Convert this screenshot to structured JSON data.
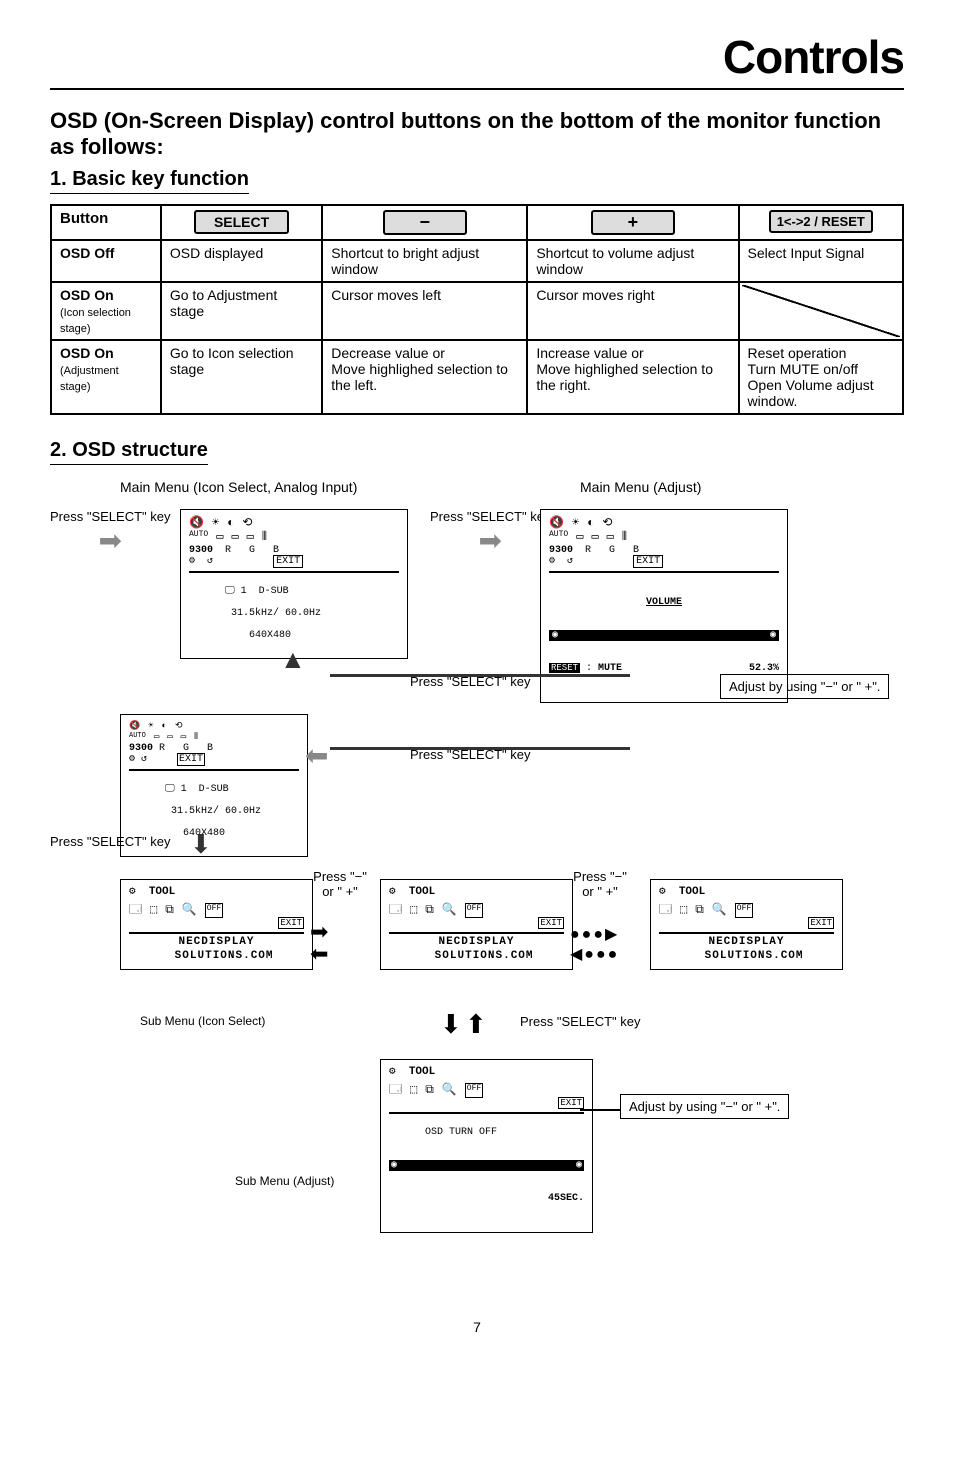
{
  "page_title": "Controls",
  "intro": "OSD (On-Screen Display) control buttons on the bottom of the monitor function as follows:",
  "section1_heading": "1. Basic key function",
  "table": {
    "headers": {
      "button": "Button",
      "select": "SELECT",
      "minus": "−",
      "plus": "+",
      "reset": "1<->2 / RESET"
    },
    "rows": [
      {
        "label": "OSD Off",
        "select": "OSD displayed",
        "minus": "Shortcut to bright adjust window",
        "plus": "Shortcut to volume adjust window",
        "reset": "Select Input Signal"
      },
      {
        "label": "OSD On",
        "label_note": "(Icon selection stage)",
        "select": "Go to Adjustment stage",
        "minus": "Cursor moves left",
        "plus": "Cursor moves right",
        "reset": ""
      },
      {
        "label": "OSD On",
        "label_note": "(Adjustment stage)",
        "select": "Go to Icon selection stage",
        "minus": "Decrease value or",
        "minus_extra": "Move highlighed selection to the left.",
        "plus": "Increase value or",
        "plus_extra": "Move highlighed selection to the right.",
        "reset": "Reset operation\nTurn MUTE on/off\nOpen Volume adjust window."
      }
    ]
  },
  "section2_heading": "2. OSD structure",
  "osd": {
    "main_icon_label": "Main Menu (Icon Select, Analog Input)",
    "main_adjust_label": "Main Menu (Adjust)",
    "press_select": "Press \"SELECT\" key",
    "press_select_short": "Press \"SELECT\" key",
    "press_minus_plus": "Press \"−\" or \" +\"",
    "adjust_hint": "Adjust by using \"−\" or \" +\".",
    "icon_row_letters": "R   G   B",
    "icon_9300": "9300",
    "exit": "EXIT",
    "dsub_line": "1  D-SUB",
    "freq_line": "31.5kHz/ 60.0Hz",
    "res_line": "640X480",
    "volume_title": "VOLUME",
    "mute_label": "MUTE",
    "reset_tag": "RESET",
    "volume_value": "52.3%",
    "tool_title": "TOOL",
    "nec_footer": "NECDISPLAY\n  SOLUTIONS.COM",
    "sub_icon_label": "Sub Menu (Icon Select)",
    "sub_adjust_label": "Sub Menu (Adjust)",
    "osd_turn_off": "OSD TURN OFF",
    "osd_timer": "45SEC."
  },
  "page_number": "7"
}
